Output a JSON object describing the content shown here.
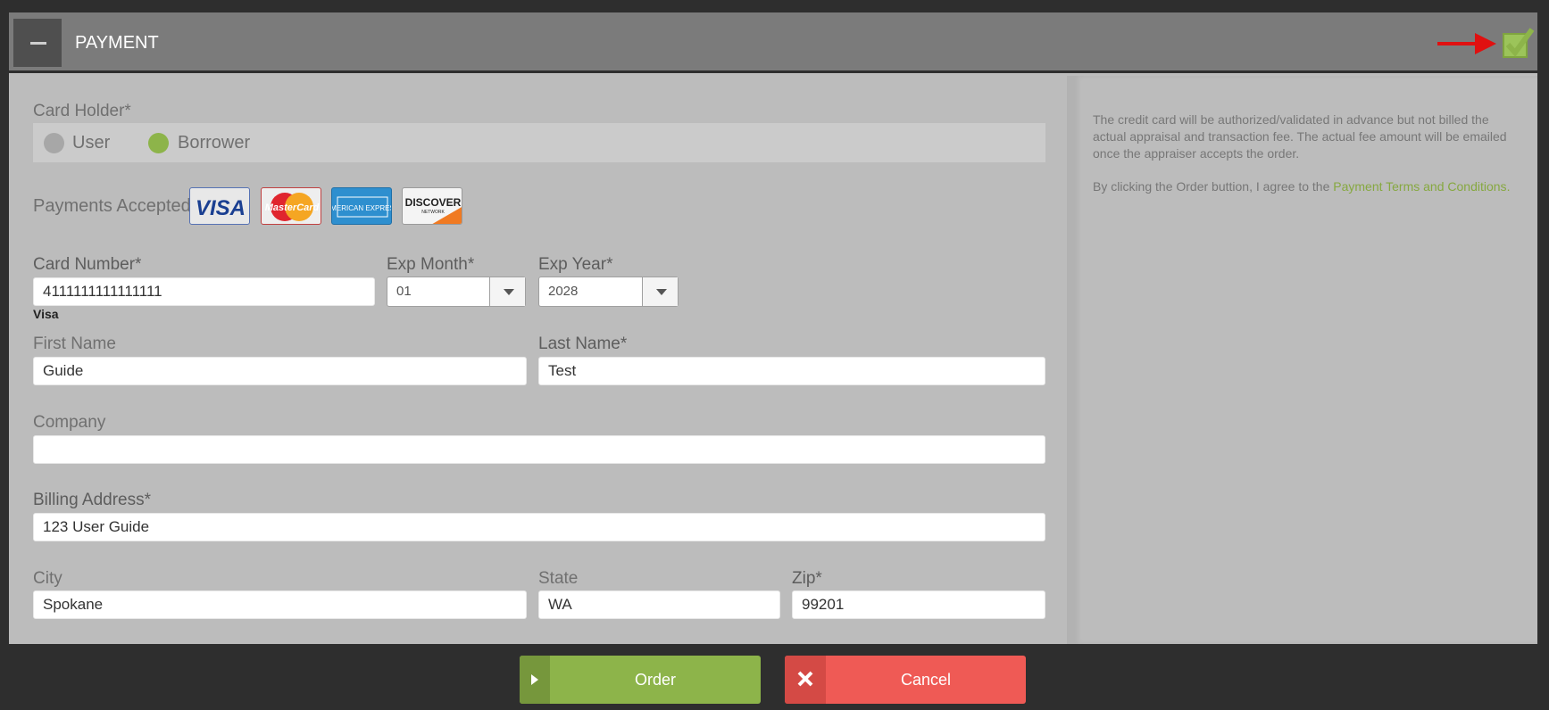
{
  "header": {
    "title": "PAYMENT"
  },
  "colors": {
    "accent_green": "#8db44a",
    "cancel_red": "#ef5a55",
    "link_green": "#86a840"
  },
  "card_holder": {
    "label": "Card Holder*",
    "options": [
      "User",
      "Borrower"
    ],
    "selected": "Borrower"
  },
  "payments": {
    "label": "Payments Accepted:",
    "cards": [
      {
        "name": "visa-card-icon",
        "text": "VISA"
      },
      {
        "name": "mastercard-card-icon",
        "text": "MasterCard"
      },
      {
        "name": "amex-card-icon",
        "text": "AMERICAN EXPRESS"
      },
      {
        "name": "discover-card-icon",
        "text": "DISCOVER",
        "sub": "NETWORK"
      }
    ]
  },
  "card_number": {
    "label": "Card Number*",
    "value": "4111111111111111",
    "type": "Visa"
  },
  "exp_month": {
    "label": "Exp Month*",
    "value": "01"
  },
  "exp_year": {
    "label": "Exp Year*",
    "value": "2028"
  },
  "first_name": {
    "label": "First Name",
    "value": "Guide"
  },
  "last_name": {
    "label": "Last Name*",
    "value": "Test"
  },
  "company": {
    "label": "Company",
    "value": ""
  },
  "billing_address": {
    "label": "Billing Address*",
    "value": "123 User Guide"
  },
  "city": {
    "label": "City",
    "value": "Spokane"
  },
  "state": {
    "label": "State",
    "value": "WA"
  },
  "zip": {
    "label": "Zip*",
    "value": "99201"
  },
  "side": {
    "notice": "The credit card will be authorized/validated in advance but not billed the actual appraisal and transaction fee. The actual fee amount will be emailed once the appraiser accepts the order.",
    "agree_prefix": "By clicking the Order buttion, I agree to the ",
    "agree_link": "Payment Terms and Conditions",
    "agree_suffix": "."
  },
  "actions": {
    "order": "Order",
    "cancel": "Cancel"
  }
}
